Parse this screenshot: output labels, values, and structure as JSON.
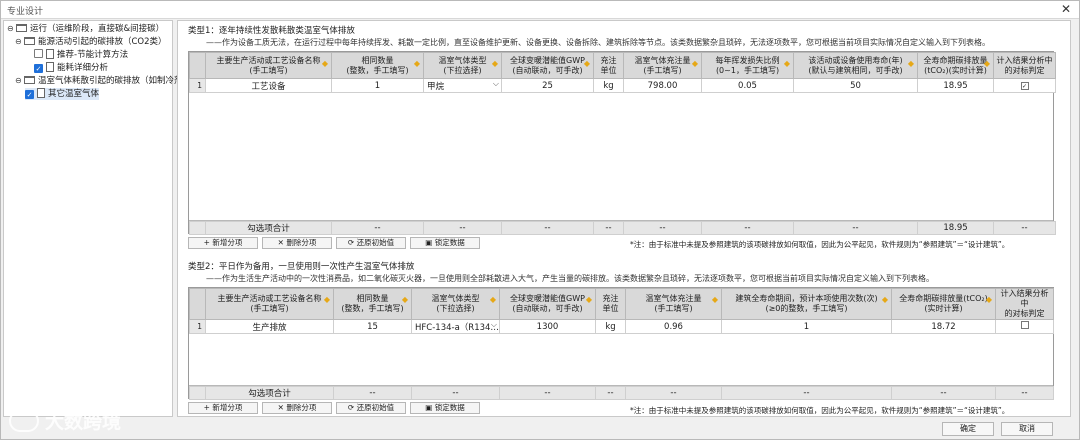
{
  "window": {
    "title": "专业设计",
    "close_icon": "close-icon"
  },
  "tree": {
    "nodes": [
      {
        "label": "运行（运维阶段，直接碳&间接碳）",
        "icon": "folder-icon"
      },
      {
        "label": "能源活动引起的碳排放（CO2类）",
        "icon": "folder-icon"
      },
      {
        "label": "推荐-节能计算方法",
        "icon": "file-icon",
        "checked": false
      },
      {
        "label": "能耗详细分析",
        "icon": "file-icon",
        "checked": true
      },
      {
        "label": "温室气体耗散引起的碳排放（如制冷剂）",
        "icon": "folder-icon"
      },
      {
        "label": "其它温室气体",
        "icon": "file-icon",
        "checked": true
      }
    ]
  },
  "section1": {
    "title": "类型1：逐年持续性发散耗散类温室气体排放",
    "desc": "——作为设备工质无法，在运行过程中每年持续挥发、耗散一定比例，直至设备维护更新、设备更换、设备拆除、建筑拆除等节点。该类数据繁杂且琐碎，无法逐项数平，您可根据当前项目实际情况自定义输入到下列表格。",
    "headers": [
      "主要生产活动或工艺设备名称\n(手工填写)",
      "相同数量\n(整数，手工填写)",
      "温室气体类型\n(下拉选择)",
      "全球变暖潜能值GWP\n(自动联动，可手改)",
      "充注\n单位",
      "温室气体充注量\n(手工填写)",
      "每年挥发损失比例\n(0~1，手工填写)",
      "该活动或设备使用寿命(年)\n(默认与建筑相同，可手改)",
      "全寿命期碳排放量\n(tCO₂)(实时计算)",
      "计入结果分析中\n的对标判定"
    ],
    "rows": [
      {
        "idx": "1",
        "name": "工艺设备",
        "qty": "1",
        "gas": "甲烷",
        "gwp": "25",
        "unit": "kg",
        "charge": "798.00",
        "rate": "0.05",
        "life": "50",
        "emission": "18.95",
        "included": true
      }
    ],
    "sum": {
      "label": "勾选项合计",
      "dash": "--",
      "emission": "18.95"
    },
    "buttons": [
      "+ 新增分项",
      "✕ 删除分项",
      "⟳ 还原初始值",
      "▣ 锁定数据"
    ],
    "note": "*注：由于标准中未提及参照建筑的该项碳排放如何取值，因此为公平起见，软件规则为“参照建筑”＝“设计建筑”。"
  },
  "section2": {
    "title": "类型2：平日作为备用，一旦使用则一次性产生温室气体排放",
    "desc": "——作为生活生产活动中的一次性消费品，如二氧化碳灭火器，一旦使用则全部耗散进入大气，产生当量的碳排放。该类数据繁杂且琐碎，无法逐项数平，您可根据当前项目实际情况自定义输入到下列表格。",
    "headers": [
      "主要生产活动或工艺设备名称\n(手工填写)",
      "相同数量\n(整数，手工填写)",
      "温室气体类型\n(下拉选择)",
      "全球变暖潜能值GWP\n(自动联动，可手改)",
      "充注\n单位",
      "温室气体充注量\n(手工填写)",
      "建筑全寿命期间，预计本项使用次数(次)\n(≥0的整数，手工填写)",
      "全寿命期碳排放量(tCO₂)\n(实时计算)",
      "计入结果分析中\n的对标判定"
    ],
    "rows": [
      {
        "idx": "1",
        "name": "生产排放",
        "qty": "15",
        "gas": "HFC-134-a（R134…",
        "gwp": "1300",
        "unit": "kg",
        "charge": "0.96",
        "times": "1",
        "emission": "18.72",
        "included": false
      }
    ],
    "sum": {
      "label": "勾选项合计",
      "dash": "--"
    },
    "buttons": [
      "+ 新增分项",
      "✕ 删除分项",
      "⟳ 还原初始值",
      "▣ 锁定数据"
    ],
    "note": "*注：由于标准中未提及参照建筑的该项碳排放如何取值，因此为公平起见，软件规则为“参照建筑”＝“设计建筑”。"
  },
  "watermark": "大数跨境",
  "footer": {
    "ok": "确定",
    "cancel": "取消"
  }
}
